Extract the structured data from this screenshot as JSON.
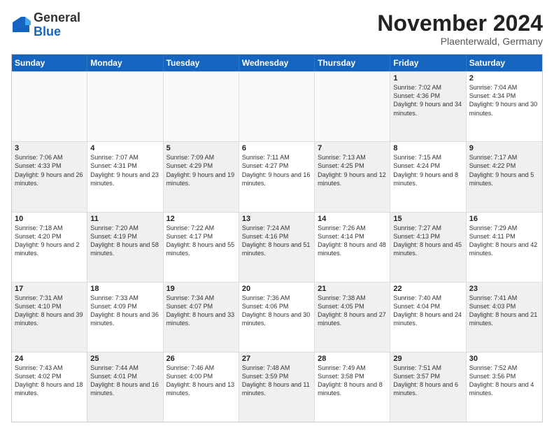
{
  "header": {
    "logo_general": "General",
    "logo_blue": "Blue",
    "month_title": "November 2024",
    "subtitle": "Plaenterwald, Germany"
  },
  "days_of_week": [
    "Sunday",
    "Monday",
    "Tuesday",
    "Wednesday",
    "Thursday",
    "Friday",
    "Saturday"
  ],
  "rows": [
    [
      {
        "day": "",
        "text": "",
        "empty": true
      },
      {
        "day": "",
        "text": "",
        "empty": true
      },
      {
        "day": "",
        "text": "",
        "empty": true
      },
      {
        "day": "",
        "text": "",
        "empty": true
      },
      {
        "day": "",
        "text": "",
        "empty": true
      },
      {
        "day": "1",
        "text": "Sunrise: 7:02 AM\nSunset: 4:36 PM\nDaylight: 9 hours and 34 minutes.",
        "shaded": true
      },
      {
        "day": "2",
        "text": "Sunrise: 7:04 AM\nSunset: 4:34 PM\nDaylight: 9 hours and 30 minutes.",
        "shaded": false
      }
    ],
    [
      {
        "day": "3",
        "text": "Sunrise: 7:06 AM\nSunset: 4:33 PM\nDaylight: 9 hours and 26 minutes.",
        "shaded": true
      },
      {
        "day": "4",
        "text": "Sunrise: 7:07 AM\nSunset: 4:31 PM\nDaylight: 9 hours and 23 minutes.",
        "shaded": false
      },
      {
        "day": "5",
        "text": "Sunrise: 7:09 AM\nSunset: 4:29 PM\nDaylight: 9 hours and 19 minutes.",
        "shaded": true
      },
      {
        "day": "6",
        "text": "Sunrise: 7:11 AM\nSunset: 4:27 PM\nDaylight: 9 hours and 16 minutes.",
        "shaded": false
      },
      {
        "day": "7",
        "text": "Sunrise: 7:13 AM\nSunset: 4:25 PM\nDaylight: 9 hours and 12 minutes.",
        "shaded": true
      },
      {
        "day": "8",
        "text": "Sunrise: 7:15 AM\nSunset: 4:24 PM\nDaylight: 9 hours and 8 minutes.",
        "shaded": false
      },
      {
        "day": "9",
        "text": "Sunrise: 7:17 AM\nSunset: 4:22 PM\nDaylight: 9 hours and 5 minutes.",
        "shaded": true
      }
    ],
    [
      {
        "day": "10",
        "text": "Sunrise: 7:18 AM\nSunset: 4:20 PM\nDaylight: 9 hours and 2 minutes.",
        "shaded": false
      },
      {
        "day": "11",
        "text": "Sunrise: 7:20 AM\nSunset: 4:19 PM\nDaylight: 8 hours and 58 minutes.",
        "shaded": true
      },
      {
        "day": "12",
        "text": "Sunrise: 7:22 AM\nSunset: 4:17 PM\nDaylight: 8 hours and 55 minutes.",
        "shaded": false
      },
      {
        "day": "13",
        "text": "Sunrise: 7:24 AM\nSunset: 4:16 PM\nDaylight: 8 hours and 51 minutes.",
        "shaded": true
      },
      {
        "day": "14",
        "text": "Sunrise: 7:26 AM\nSunset: 4:14 PM\nDaylight: 8 hours and 48 minutes.",
        "shaded": false
      },
      {
        "day": "15",
        "text": "Sunrise: 7:27 AM\nSunset: 4:13 PM\nDaylight: 8 hours and 45 minutes.",
        "shaded": true
      },
      {
        "day": "16",
        "text": "Sunrise: 7:29 AM\nSunset: 4:11 PM\nDaylight: 8 hours and 42 minutes.",
        "shaded": false
      }
    ],
    [
      {
        "day": "17",
        "text": "Sunrise: 7:31 AM\nSunset: 4:10 PM\nDaylight: 8 hours and 39 minutes.",
        "shaded": true
      },
      {
        "day": "18",
        "text": "Sunrise: 7:33 AM\nSunset: 4:09 PM\nDaylight: 8 hours and 36 minutes.",
        "shaded": false
      },
      {
        "day": "19",
        "text": "Sunrise: 7:34 AM\nSunset: 4:07 PM\nDaylight: 8 hours and 33 minutes.",
        "shaded": true
      },
      {
        "day": "20",
        "text": "Sunrise: 7:36 AM\nSunset: 4:06 PM\nDaylight: 8 hours and 30 minutes.",
        "shaded": false
      },
      {
        "day": "21",
        "text": "Sunrise: 7:38 AM\nSunset: 4:05 PM\nDaylight: 8 hours and 27 minutes.",
        "shaded": true
      },
      {
        "day": "22",
        "text": "Sunrise: 7:40 AM\nSunset: 4:04 PM\nDaylight: 8 hours and 24 minutes.",
        "shaded": false
      },
      {
        "day": "23",
        "text": "Sunrise: 7:41 AM\nSunset: 4:03 PM\nDaylight: 8 hours and 21 minutes.",
        "shaded": true
      }
    ],
    [
      {
        "day": "24",
        "text": "Sunrise: 7:43 AM\nSunset: 4:02 PM\nDaylight: 8 hours and 18 minutes.",
        "shaded": false
      },
      {
        "day": "25",
        "text": "Sunrise: 7:44 AM\nSunset: 4:01 PM\nDaylight: 8 hours and 16 minutes.",
        "shaded": true
      },
      {
        "day": "26",
        "text": "Sunrise: 7:46 AM\nSunset: 4:00 PM\nDaylight: 8 hours and 13 minutes.",
        "shaded": false
      },
      {
        "day": "27",
        "text": "Sunrise: 7:48 AM\nSunset: 3:59 PM\nDaylight: 8 hours and 11 minutes.",
        "shaded": true
      },
      {
        "day": "28",
        "text": "Sunrise: 7:49 AM\nSunset: 3:58 PM\nDaylight: 8 hours and 8 minutes.",
        "shaded": false
      },
      {
        "day": "29",
        "text": "Sunrise: 7:51 AM\nSunset: 3:57 PM\nDaylight: 8 hours and 6 minutes.",
        "shaded": true
      },
      {
        "day": "30",
        "text": "Sunrise: 7:52 AM\nSunset: 3:56 PM\nDaylight: 8 hours and 4 minutes.",
        "shaded": false
      }
    ]
  ]
}
